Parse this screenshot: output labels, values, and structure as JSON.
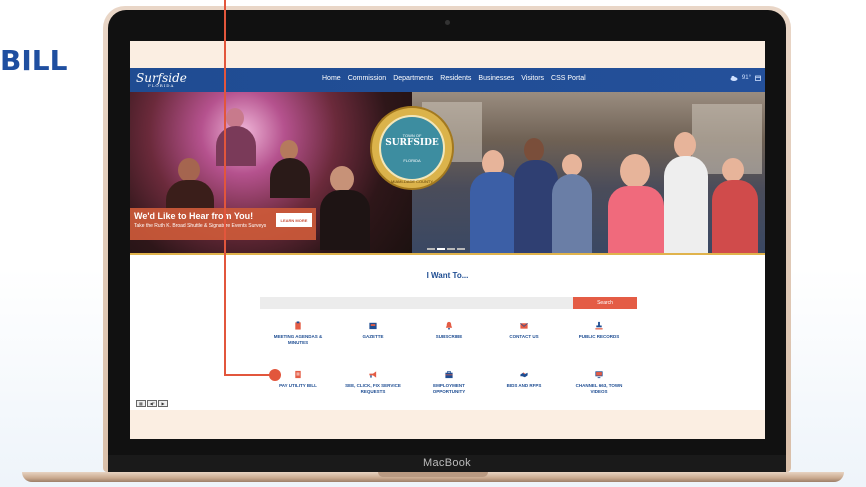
{
  "brand_text": "BILL",
  "laptop": {
    "label": "MacBook"
  },
  "site": {
    "logo": {
      "text": "Surfside",
      "subtext": "FLORIDA"
    },
    "nav": [
      "Home",
      "Commission",
      "Departments",
      "Residents",
      "Businesses",
      "Visitors",
      "CSS Portal"
    ],
    "weather": {
      "temp": "91°"
    },
    "hero": {
      "seal": {
        "top": "TOWN OF",
        "name": "SURFSIDE",
        "state": "FLORIDA",
        "county": "MIAMI-DADE COUNTY"
      },
      "promo_title": "We'd Like to Hear from You!",
      "promo_subtitle": "Take the Ruth K. Broad Shuttle & Signature Events Surveys",
      "cta": "LEARN MORE"
    },
    "i_want_title": "I Want To...",
    "search_button": "Search",
    "quick_links": [
      {
        "label": "MEETING AGENDAS & MINUTES",
        "icon": "clipboard-icon"
      },
      {
        "label": "GAZETTE",
        "icon": "newspaper-icon"
      },
      {
        "label": "SUBSCRIBE",
        "icon": "bell-icon"
      },
      {
        "label": "CONTACT US",
        "icon": "envelope-icon"
      },
      {
        "label": "PUBLIC RECORDS",
        "icon": "stamp-icon"
      },
      {
        "label": "PAY UTILITY BILL",
        "icon": "bill-icon"
      },
      {
        "label": "SEE, CLICK, FIX SERVICE REQUESTS",
        "icon": "megaphone-icon"
      },
      {
        "label": "EMPLOYMENT OPPORTUNITY",
        "icon": "briefcase-icon"
      },
      {
        "label": "BIDS AND RFPS",
        "icon": "handshake-icon"
      },
      {
        "label": "CHANNEL 663, TOWN VIDEOS",
        "icon": "monitor-icon"
      }
    ]
  },
  "colors": {
    "accent": "#e2563c",
    "navy": "#1e4d92",
    "nav_bg": "#24509a"
  }
}
